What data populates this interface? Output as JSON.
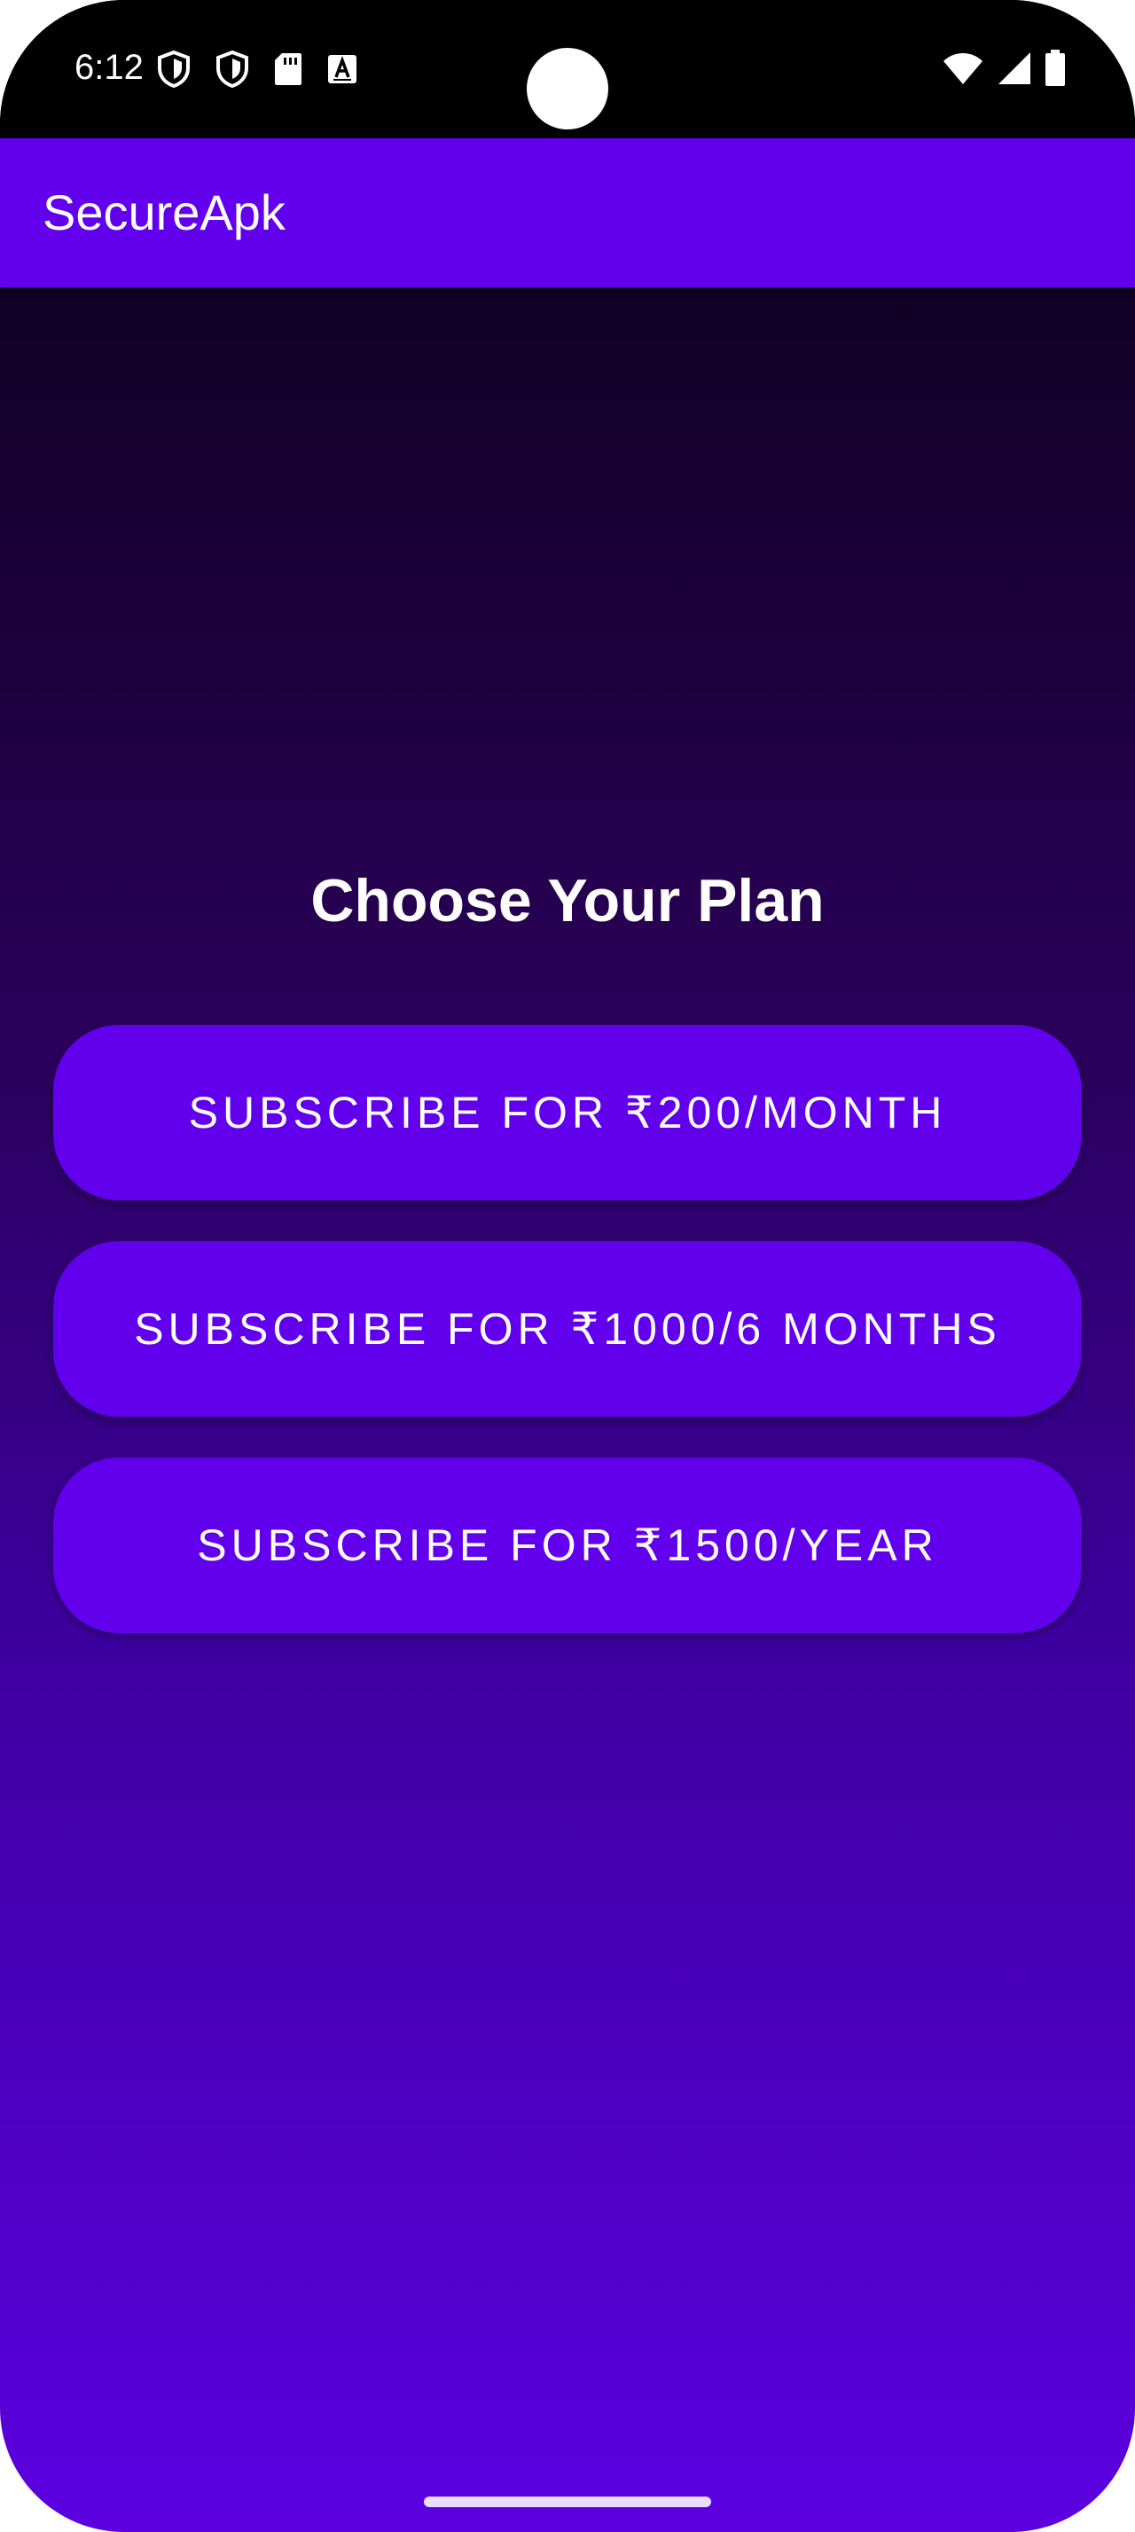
{
  "status_bar": {
    "time": "6:12",
    "left_icons": [
      "shield-icon",
      "shield-icon",
      "sd-card-icon",
      "keyboard-a-icon"
    ],
    "right_icons": [
      "wifi-icon",
      "signal-icon",
      "battery-icon"
    ]
  },
  "app_bar": {
    "title": "SecureApk",
    "color": "#6200ee"
  },
  "main": {
    "heading": "Choose Your Plan",
    "plans": [
      {
        "label": "SUBSCRIBE FOR ₹200/MONTH"
      },
      {
        "label": "SUBSCRIBE FOR ₹1000/6 MONTHS"
      },
      {
        "label": "SUBSCRIBE FOR ₹1500/YEAR"
      }
    ]
  },
  "colors": {
    "background_top": "#0f0121",
    "background_bottom": "#5c00e0",
    "button": "#6200ee"
  }
}
